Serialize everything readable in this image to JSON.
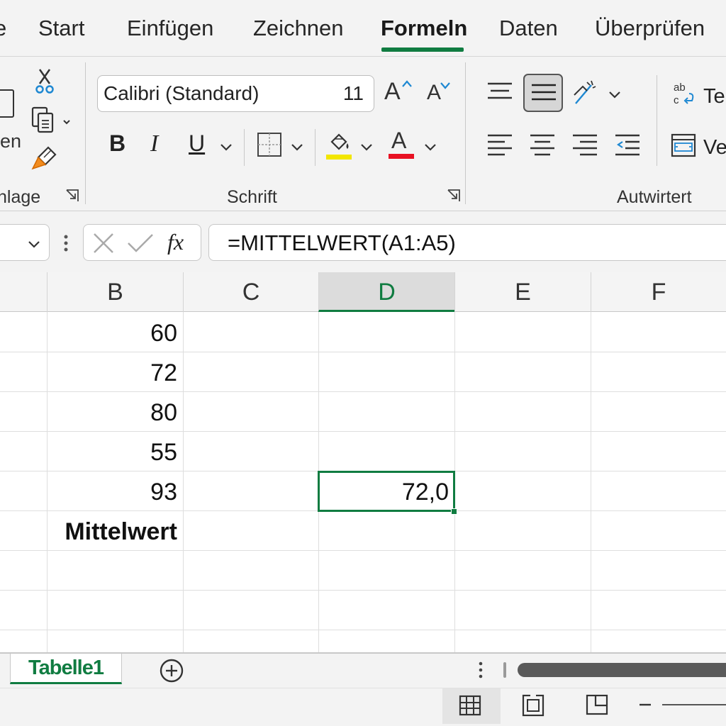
{
  "tabs": [
    {
      "label": "e"
    },
    {
      "label": "Start"
    },
    {
      "label": "Einfügen"
    },
    {
      "label": "Zeichnen"
    },
    {
      "label": "Formeln",
      "active": true
    },
    {
      "label": "Daten"
    },
    {
      "label": "Überprüfen"
    }
  ],
  "ribbon": {
    "clipboard_paste_label": "en",
    "clipboard_group_label": "hlage",
    "font_group_label": "Schrift",
    "font_name": "Calibri (Standard)",
    "font_size": "11",
    "bold_label": "B",
    "italic_label": "I",
    "underline_label": "U",
    "font_color_letter": "A",
    "grow_font_letter": "A",
    "shrink_font_letter": "A",
    "alignment_group_label": "Autwirtert",
    "wrap_text_label": "Te",
    "merge_label": "Ve",
    "colors": {
      "accent": "#107c41",
      "highlight": "#f2e600",
      "font_color": "#e81123"
    }
  },
  "formula_bar": {
    "fx_label": "fx",
    "formula": "=MITTELWERT(A1:A5)"
  },
  "grid": {
    "columns": [
      "B",
      "C",
      "D",
      "E",
      "F"
    ],
    "selected_column": "D",
    "column_b_values": [
      "60",
      "72",
      "80",
      "55",
      "93",
      "Mittelwert"
    ],
    "selected_cell_value": "72,0"
  },
  "sheets": [
    {
      "label": "Tabelle1",
      "active": true
    }
  ]
}
